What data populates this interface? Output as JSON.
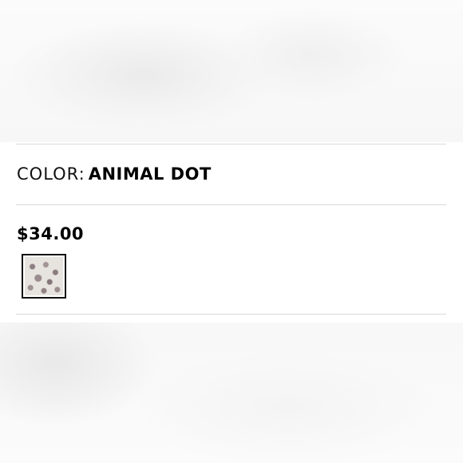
{
  "product": {
    "color_label": "COLOR:",
    "color_value": "ANIMAL DOT",
    "price": "$34.00",
    "swatches": [
      {
        "name": "ANIMAL DOT",
        "selected": true,
        "pattern": "animal-dot"
      }
    ]
  },
  "colors": {
    "text": "#111111",
    "divider": "#d9d9d9",
    "swatch_border": "#111111"
  }
}
